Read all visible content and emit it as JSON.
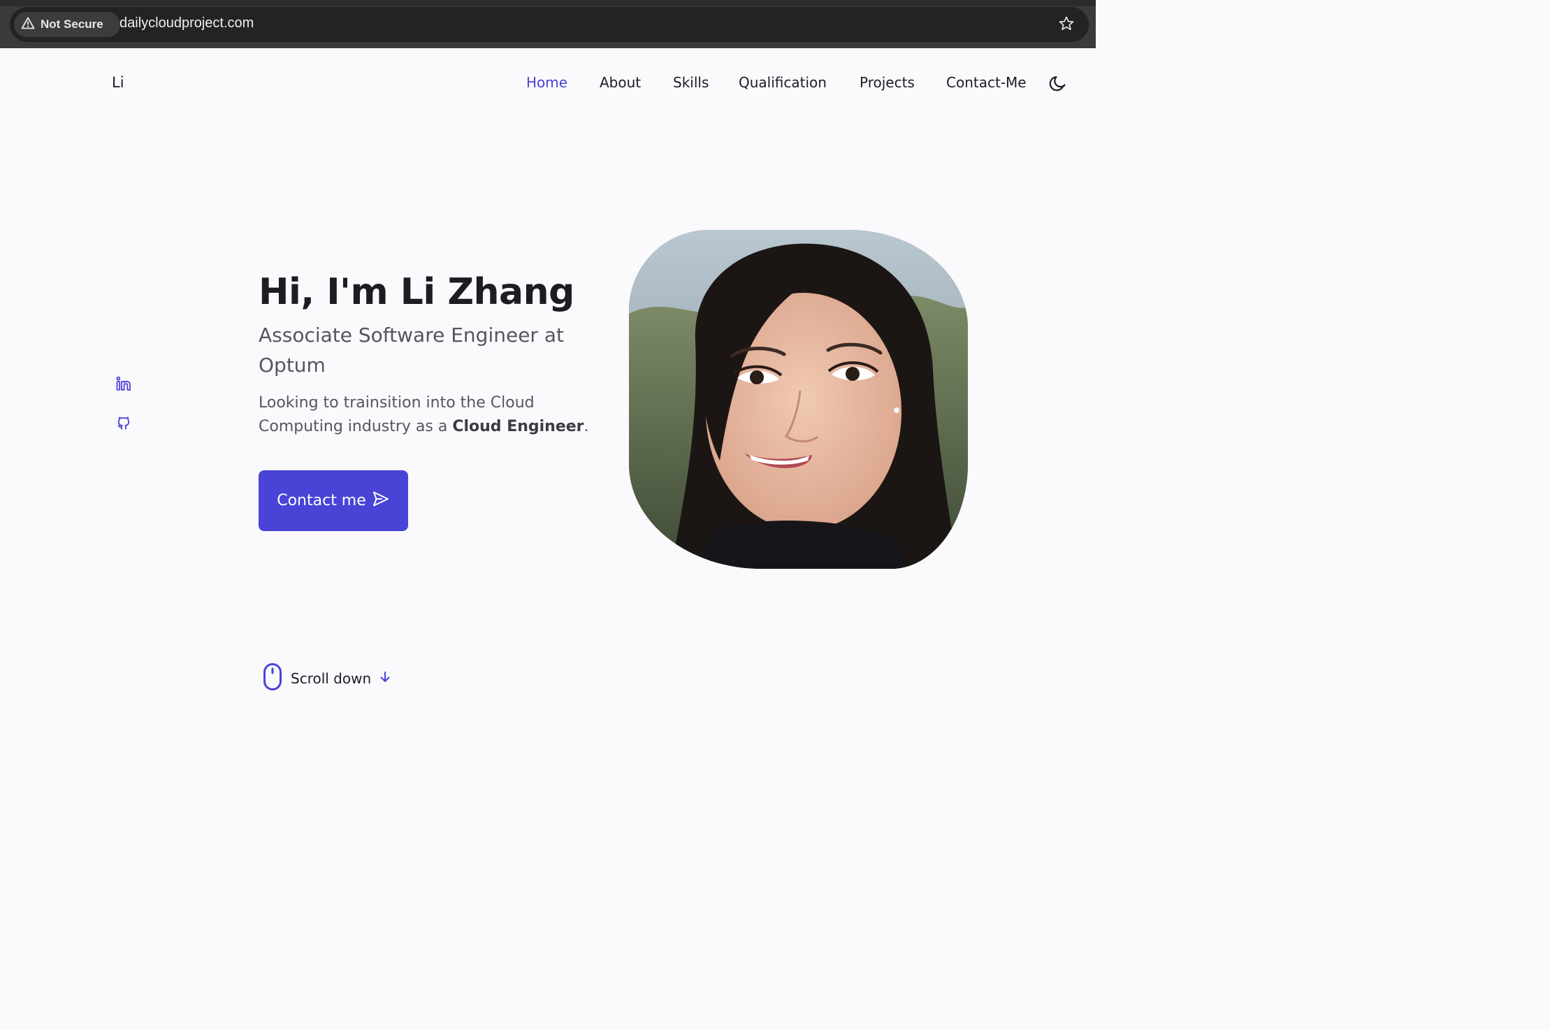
{
  "browser": {
    "security_label": "Not Secure",
    "url": "dailycloudproject.com",
    "icons": [
      "warning-icon",
      "bookmark-star-icon"
    ]
  },
  "header": {
    "logo": "Li",
    "nav": [
      "Home",
      "About",
      "Skills",
      "Qualification",
      "Projects",
      "Contact-Me"
    ],
    "active_nav": "Home",
    "theme_toggle_icon": "moon-icon"
  },
  "socials": [
    "linkedin-icon",
    "github-icon"
  ],
  "hero": {
    "title": "Hi, I'm Li Zhang",
    "subtitle": "Associate Software Engineer at Optum",
    "description_prefix": "Looking to trainsition into the Cloud Computing industry as a ",
    "description_bold": "Cloud Engineer",
    "description_suffix": ".",
    "button_label": "Contact me",
    "button_icon": "send-icon",
    "portrait_alt": "profile photo"
  },
  "scroll": {
    "label": "Scroll down",
    "icons": [
      "mouse-icon",
      "arrow-down-icon"
    ]
  },
  "colors": {
    "accent": "#4944d6",
    "background": "#faf9fc",
    "text": "#1d1c22",
    "muted": "#56555e"
  }
}
